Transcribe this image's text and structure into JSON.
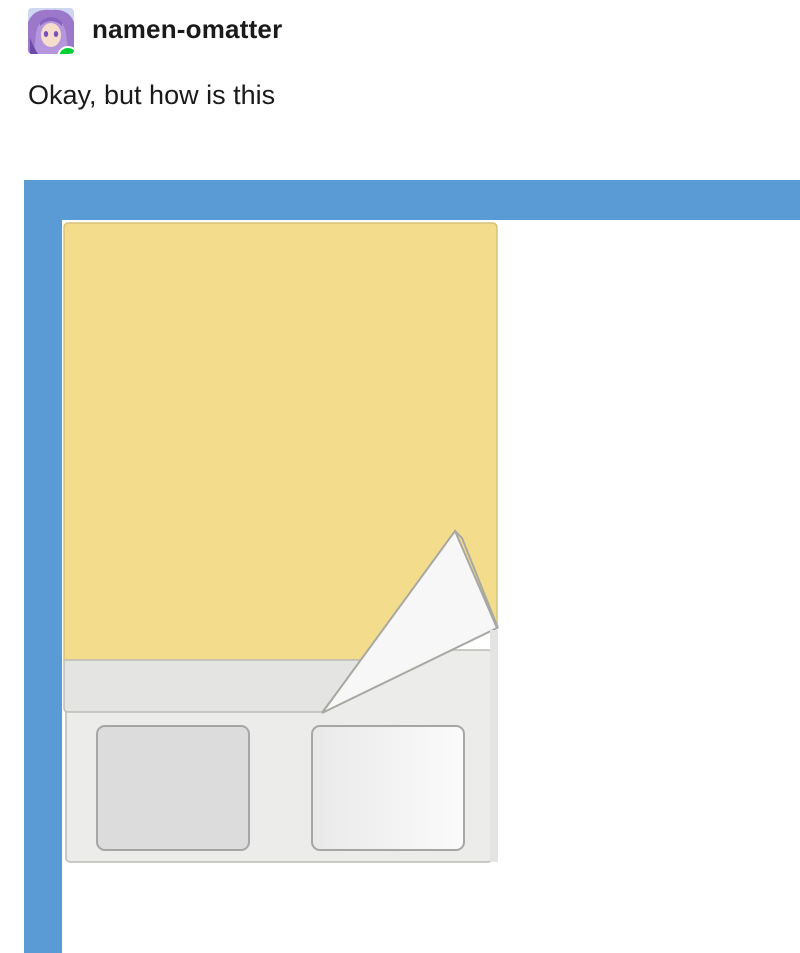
{
  "post": {
    "username": "namen-omatter",
    "text": "Okay, but how is this",
    "avatar_icon": "avatar-anime-purple-hair",
    "badge_icon": "reblog-icon"
  },
  "image": {
    "description_icon": "folded-note-illustration",
    "colors": {
      "frame": "#5b9bd5",
      "note": "#f3dc8c",
      "tray": "#ececea",
      "fold": "#f7f7f7"
    }
  }
}
